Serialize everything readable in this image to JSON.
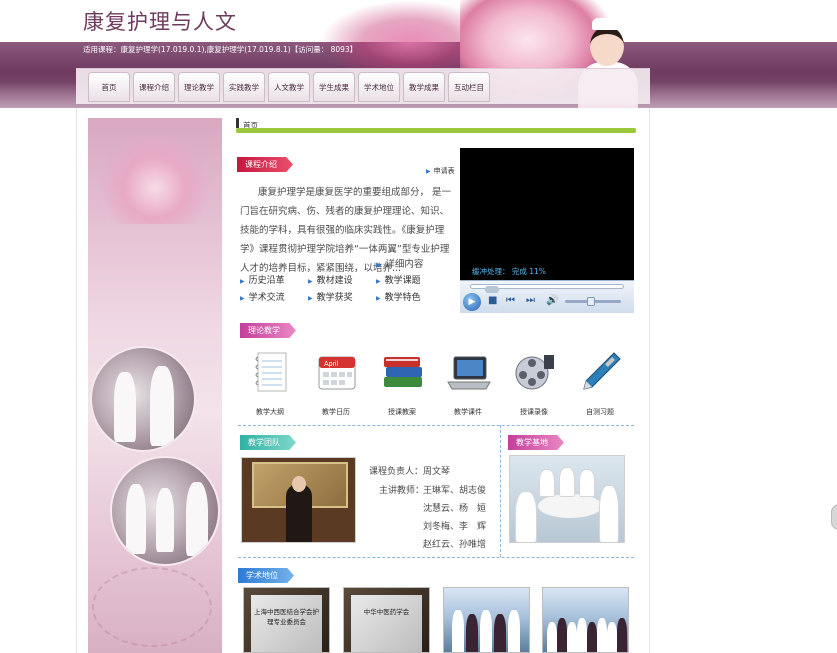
{
  "header": {
    "site_title": "康复护理与人文",
    "course_info": "适用课程：康复护理学(17.019.0.1),康复护理学(17.019.8.1)【访问量： 8093】"
  },
  "nav": {
    "items": [
      {
        "label": "首页"
      },
      {
        "label": "课程介绍"
      },
      {
        "label": "理论教学"
      },
      {
        "label": "实践教学"
      },
      {
        "label": "人文教学"
      },
      {
        "label": "学生成果"
      },
      {
        "label": "学术地位"
      },
      {
        "label": "教学成果"
      },
      {
        "label": "互动栏目"
      }
    ]
  },
  "breadcrumb": {
    "current": "首页"
  },
  "course_intro": {
    "title": "课程介绍",
    "apply_link": "申请表",
    "text": "康复护理学是康复医学的重要组成部分， 是一门旨在研究病、伤、残者的康复护理理论、知识、技能的学科，具有很强的临床实践性。《康复护理学》课程贯彻护理学院培养“一体两翼”型专业护理人才的培养目标，紧紧围绕，以培养...",
    "detail_link": "详细内容",
    "links": [
      {
        "label": "历史沿革"
      },
      {
        "label": "教材建设"
      },
      {
        "label": "教学课题"
      },
      {
        "label": "学术交流"
      },
      {
        "label": "教学获奖"
      },
      {
        "label": "教学特色"
      }
    ]
  },
  "player": {
    "status": "缓冲处理： 完成 11%"
  },
  "theory": {
    "title": "理论教学",
    "items": [
      {
        "label": "教学大纲",
        "icon": "notebook-icon"
      },
      {
        "label": "教学日历",
        "icon": "calendar-icon",
        "calendar_month": "April"
      },
      {
        "label": "授课教案",
        "icon": "books-icon"
      },
      {
        "label": "教学课件",
        "icon": "laptop-icon"
      },
      {
        "label": "授课录像",
        "icon": "film-reel-icon"
      },
      {
        "label": "自测习题",
        "icon": "pen-icon"
      }
    ]
  },
  "team": {
    "title": "教学团队",
    "leader_label": "课程负责人：",
    "leader": "周文琴",
    "teachers_label": "主讲教师：",
    "teachers": [
      "王琳军、胡志俊",
      "沈慧云、杨　姮",
      "刘冬梅、李　辉",
      "赵红云、孙唯增"
    ]
  },
  "base": {
    "title": "教学基地"
  },
  "status": {
    "title": "学术地位",
    "plaques": [
      {
        "text": "上海中西医结合学会护理专业委员会"
      },
      {
        "text": "中华中医药学会"
      }
    ]
  },
  "colors": {
    "header_band": "#6e3a60",
    "accent_green": "#9ac83a",
    "link_arrow": "#3a78c8",
    "tag_red": "#c8163e",
    "tag_pink": "#c43f9c",
    "tag_teal": "#2fb3a4",
    "tag_blue": "#2d7bd4"
  }
}
